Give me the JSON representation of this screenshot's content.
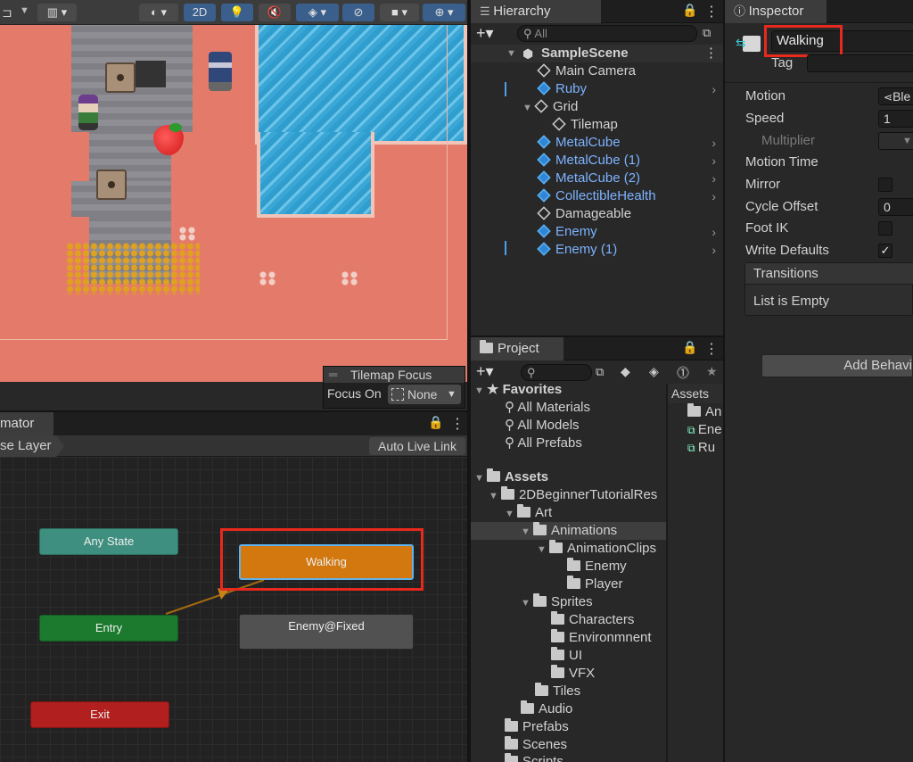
{
  "scene": {
    "toolbar": {
      "two_d_label": "2D"
    },
    "tilemap_focus": {
      "title": "Tilemap Focus",
      "focus_on_label": "Focus On",
      "focus_value": "None"
    }
  },
  "hierarchy": {
    "tab_label": "Hierarchy",
    "search_placeholder": "All",
    "scene_name": "SampleScene",
    "items": [
      {
        "label": "Main Camera"
      },
      {
        "label": "Ruby"
      },
      {
        "label": "Grid"
      },
      {
        "label": "Tilemap"
      },
      {
        "label": "MetalCube"
      },
      {
        "label": "MetalCube (1)"
      },
      {
        "label": "MetalCube (2)"
      },
      {
        "label": "CollectibleHealth"
      },
      {
        "label": "Damageable"
      },
      {
        "label": "Enemy"
      },
      {
        "label": "Enemy (1)"
      }
    ]
  },
  "project": {
    "tab_label": "Project",
    "assets_breadcrumb": "Assets",
    "favorites_label": "Favorites",
    "favorites": [
      "All Materials",
      "All Models",
      "All Prefabs"
    ],
    "assets_label": "Assets",
    "tree": [
      {
        "label": "2DBeginnerTutorialRes"
      },
      {
        "label": "Art"
      },
      {
        "label": "Animations"
      },
      {
        "label": "AnimationClips"
      },
      {
        "label": "Enemy"
      },
      {
        "label": "Player"
      },
      {
        "label": "Sprites"
      },
      {
        "label": "Characters"
      },
      {
        "label": "Environmnent"
      },
      {
        "label": "UI"
      },
      {
        "label": "VFX"
      },
      {
        "label": "Tiles"
      },
      {
        "label": "Audio"
      },
      {
        "label": "Prefabs"
      },
      {
        "label": "Scenes"
      },
      {
        "label": "Scripts"
      }
    ],
    "right_items": [
      "An",
      "Ene",
      "Ru"
    ]
  },
  "inspector": {
    "tab_label": "Inspector",
    "object_name": "Walking",
    "tag_label": "Tag",
    "motion_label": "Motion",
    "motion_value": "Ble",
    "speed_label": "Speed",
    "speed_value": "1",
    "multiplier_label": "Multiplier",
    "motion_time_label": "Motion Time",
    "mirror_label": "Mirror",
    "cycle_offset_label": "Cycle Offset",
    "cycle_offset_value": "0",
    "foot_ik_label": "Foot IK",
    "write_defaults_label": "Write Defaults",
    "write_defaults_check": "✓",
    "transitions_label": "Transitions",
    "list_empty_label": "List is Empty",
    "add_behaviour_label": "Add Behavi"
  },
  "animator": {
    "tab_label": "mator",
    "layer_label": "se Layer",
    "auto_live_link_label": "Auto Live Link",
    "nodes": {
      "any_state": "Any State",
      "walking": "Walking",
      "entry": "Entry",
      "enemy_fixed": "Enemy@Fixed",
      "exit": "Exit"
    }
  },
  "colors": {
    "accent_highlight": "#e8291d",
    "prefab_text": "#7cb3ff",
    "any_state_node": "#3e8f7f",
    "walking_node": "#d2780f",
    "entry_node": "#1c7a2e",
    "exit_node": "#b11f1f",
    "default_node": "#515151"
  }
}
